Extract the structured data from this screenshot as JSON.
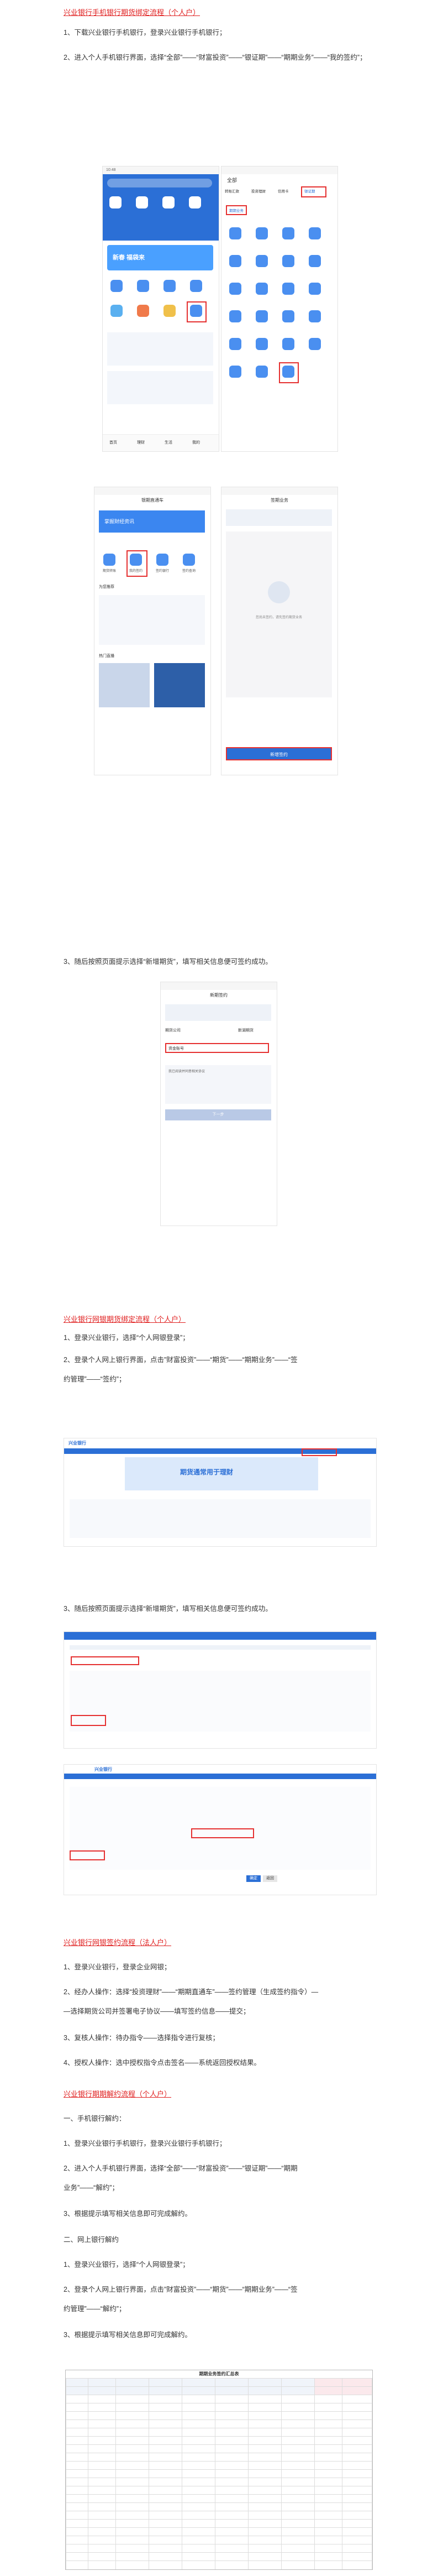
{
  "section1": {
    "title": "兴业银行手机银行期货绑定流程（个人户）",
    "step1": "1、下载兴业银行手机银行，登录兴业银行手机银行；",
    "step2": "2、进入个人手机银行界面，选择“全部”——“财富投资”——“银证期”——“期期业务”——“我的签约”；",
    "step3": "3、随后按照页面提示选择“新增期货”，填写相关信息便可签约成功。"
  },
  "section2": {
    "title": "兴业银行网银期货绑定流程（个人户）",
    "step1": "1、登录兴业银行，选择“个人网银登录”；",
    "step2a": "2、登录个人网上银行界面，点击”财富投资”——“期货”——“期期业务”——“签",
    "step2b": "约管理”——“签约”；",
    "step3": "3、随后按照页面提示选择“新增期货”，填写相关信息便可签约成功。"
  },
  "section3": {
    "title": "兴业银行网银签约流程（法人户）",
    "step1": "1、登录兴业银行，登录企业网银；",
    "step2a": "2、经办人操作：选择“投资理财”——“期期直通车”——签约管理（生成签约指令）—",
    "step2b": "—选择期货公司并签署电子协议——填写签约信息——提交；",
    "step3": "3、复核人操作：待办指令——选择指令进行复核；",
    "step4": "4、授权人操作：选中授权指令点击签名——系统返回授权结果。"
  },
  "section4": {
    "title": "兴业银行期期解约流程（个人户）",
    "sub1": "一、手机银行解约：",
    "m1": "1、登录兴业银行手机银行，登录兴业银行手机银行；",
    "m2a": "2、进入个人手机银行界面，选择“全部”——“财富投资”——“银证期”——“期期",
    "m2b": "业务”——“解约”；",
    "m3": "3、根据提示填写相关信息即可完成解约。",
    "sub2": "二、网上银行解约",
    "n1": "1、登录兴业银行，选择“个人网银登录”；",
    "n2a": "2、登录个人网上银行界面，点击”财富投资”——“期货”——“期期业务”——“签",
    "n2b": "约管理”——“解约”；",
    "n3": "3、根据提示填写相关信息即可完成解约。"
  },
  "phone1": {
    "time": "10:48",
    "banner": "新春 福袋来",
    "nav_items": [
      "首页",
      "理财",
      "生活",
      "我的"
    ]
  },
  "phone2": {
    "title": "全部",
    "tabs": [
      "转账汇款",
      "投资理财",
      "信用卡",
      "银证期"
    ],
    "highlight": "银证期",
    "selected": "期期业务"
  },
  "phone3": {
    "title": "银期直通车",
    "promo": "掌握财经资讯",
    "icons": [
      "期货转账",
      "我的签约",
      "签约银行",
      "签约查询"
    ],
    "section": "为您推荐",
    "hot": "热门直播"
  },
  "phone4": {
    "title": "签期业务",
    "empty_text": "您尚未签约，请先签约期货业务",
    "button": "新增签约"
  },
  "phone5": {
    "title": "新期签约",
    "field1": "期货公司",
    "value1": "新湖期货",
    "field2": "资金账号",
    "agree": "我已阅读并同意相关协议",
    "button": "下一步"
  },
  "web": {
    "bank_name": "兴业银行",
    "banner": "期货通常用于理财",
    "btn_ok": "确定",
    "btn_cancel": "返回"
  },
  "table": {
    "title": "期期业务签约汇总表"
  },
  "colors": {
    "accent_red": "#e53030",
    "bank_blue": "#2b6fd6"
  }
}
